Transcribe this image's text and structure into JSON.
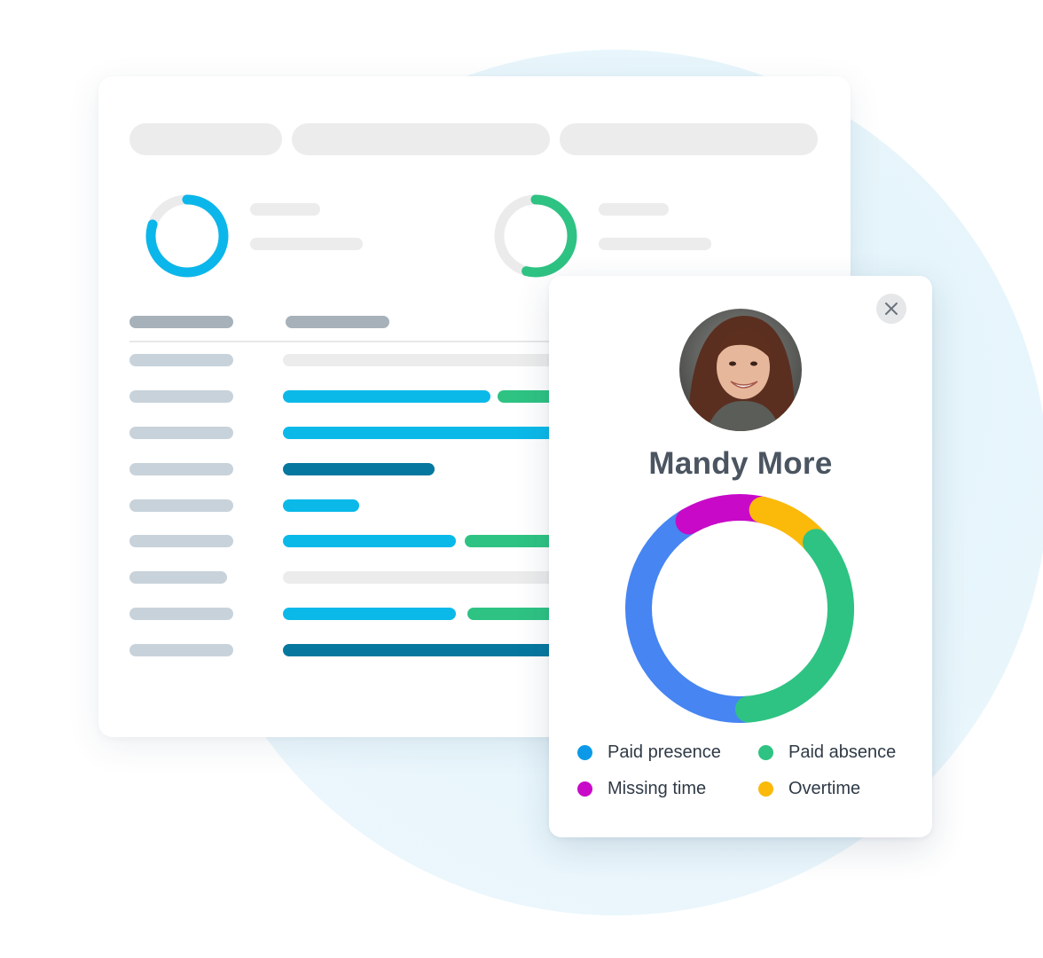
{
  "profile": {
    "name": "Mandy More",
    "close_icon": "close-icon",
    "avatar": "avatar-photo"
  },
  "summary": {
    "ring_1": {
      "progress": 0.8,
      "color": "#0bb6ea"
    },
    "ring_2": {
      "progress": 0.54,
      "color": "#2ec383"
    }
  },
  "chart_data": {
    "type": "pie",
    "labels": [
      "Paid presence",
      "Missing time",
      "Overtime",
      "Paid absence"
    ],
    "values": [
      43,
      12,
      10,
      35
    ],
    "colors": [
      "#4685f2",
      "#c809c8",
      "#fbb90a",
      "#2ec383"
    ]
  },
  "legend": {
    "paid_presence": {
      "label": "Paid presence",
      "color": "#0c9ae8"
    },
    "paid_absence": {
      "label": "Paid absence",
      "color": "#2ec383"
    },
    "missing_time": {
      "label": "Missing time",
      "color": "#c809c8"
    },
    "overtime": {
      "label": "Overtime",
      "color": "#fbb90a"
    }
  },
  "colors": {
    "blue_bar": "#0bb9e9",
    "green_bar": "#2ec383",
    "dark_bar": "#06789f",
    "placeholder": "#ececec",
    "label_placeholder": "#c8d2da"
  }
}
